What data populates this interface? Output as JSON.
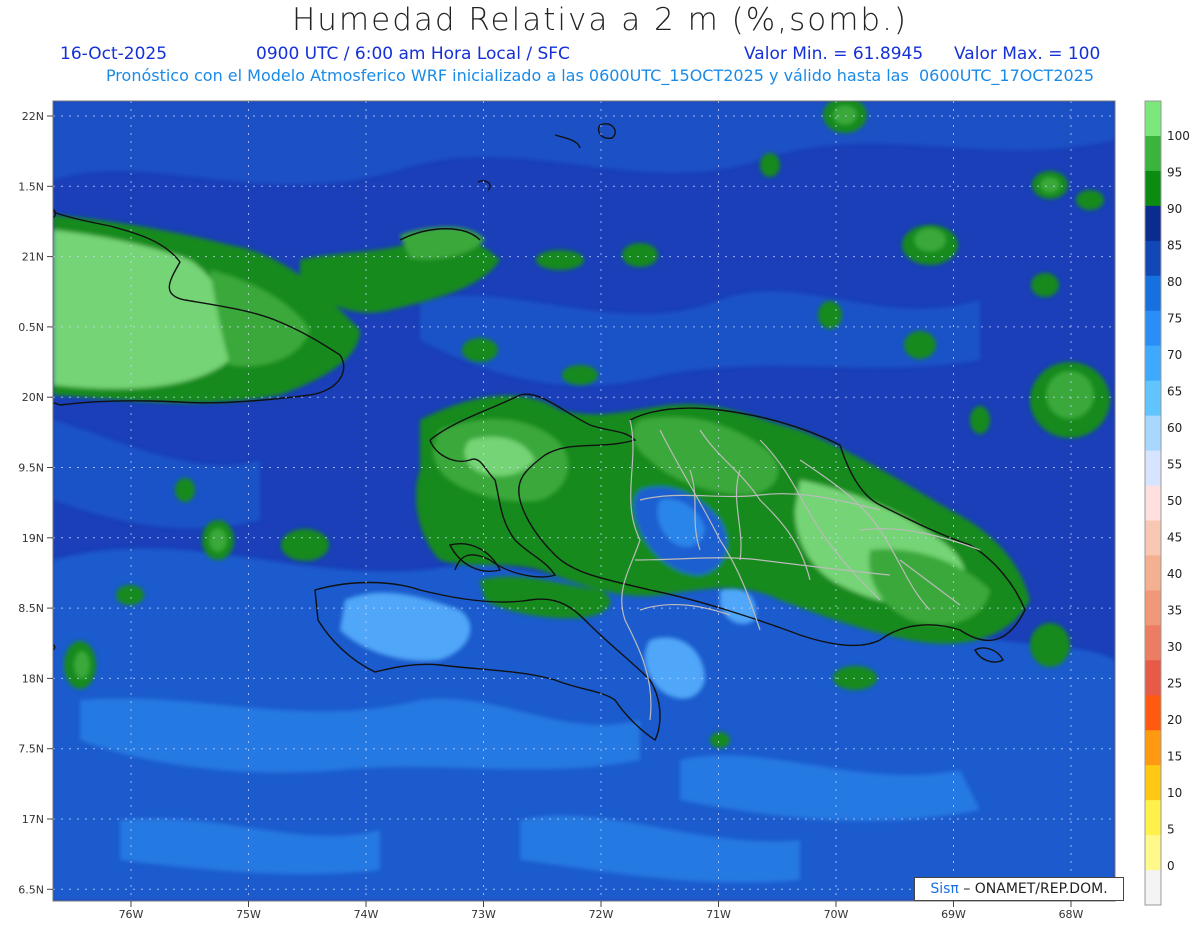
{
  "header": {
    "title": "Humedad Relativa a 2 m (%,somb.)",
    "date": "16-Oct-2025",
    "time_info": "0900 UTC / 6:00 am Hora Local / SFC",
    "valor_min": "Valor Min. = 61.8945",
    "valor_max": "Valor Max. = 100",
    "forecast_note": "Pronóstico con el Modelo Atmosferico WRF inicializado a las 0600UTC_15OCT2025 y válido hasta las  0600UTC_17OCT2025"
  },
  "map": {
    "lat_ticks": [
      "22N",
      "1.5N",
      "21N",
      "0.5N",
      "20N",
      "9.5N",
      "19N",
      "8.5N",
      "18N",
      "7.5N",
      "17N",
      "6.5N"
    ],
    "lon_ticks": [
      "76W",
      "75W",
      "74W",
      "73W",
      "72W",
      "71W",
      "70W",
      "69W",
      "68W"
    ],
    "colors": {
      "deep_ocean": "#1a3fb8",
      "mid_blue": "#1e5fd0",
      "light_blue": "#2f8ef0",
      "cyan_blue": "#5ab4ff",
      "dark_green": "#178a1c",
      "mid_green": "#3aa83a",
      "light_green": "#74d474",
      "coastline": "#111111",
      "province_border": "#bbbbbb"
    }
  },
  "colorbar": {
    "labels": [
      "100",
      "95",
      "90",
      "85",
      "80",
      "75",
      "70",
      "65",
      "60",
      "55",
      "50",
      "45",
      "40",
      "35",
      "30",
      "25",
      "20",
      "15",
      "10",
      "5",
      "0"
    ],
    "colors": [
      "#7ce87c",
      "#3ab43c",
      "#0b8c10",
      "#0a2c8e",
      "#1247b8",
      "#1670e0",
      "#2a8ef8",
      "#3eaaff",
      "#60c4ff",
      "#a8d8ff",
      "#d6e4ff",
      "#ffe0e0",
      "#f8c8b4",
      "#f4b090",
      "#f09878",
      "#ec7c62",
      "#e85a48",
      "#ff5a10",
      "#ff9a10",
      "#ffc814",
      "#fff04a",
      "#fff88a",
      "#f4f4f4"
    ]
  },
  "credit": {
    "brand": "Sisπ",
    "text": "– ONAMET/REP.DOM."
  }
}
